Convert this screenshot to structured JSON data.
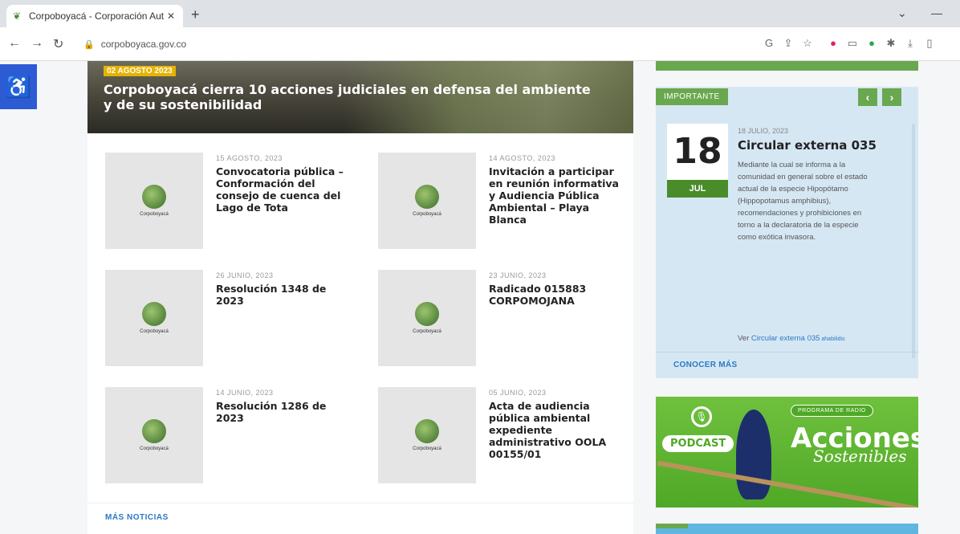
{
  "browser": {
    "tab_title": "Corpoboyacá - Corporación Aut",
    "tab_close": "✕",
    "new_tab": "+",
    "url": "corpoboyaca.gov.co",
    "minimize": "—",
    "chevron": "⌄"
  },
  "hero": {
    "date": "02 AGOSTO 2023",
    "title": "Corpoboyacá cierra 10 acciones judiciales en defensa del ambiente y de su sostenibilidad"
  },
  "news": [
    {
      "date": "15 AGOSTO, 2023",
      "title": "Convocatoria pública – Conformación del consejo de cuenca del Lago de Tota",
      "logo": "Corpoboyacá"
    },
    {
      "date": "14 AGOSTO, 2023",
      "title": "Invitación a participar en reunión informativa y Audiencia Pública Ambiental – Playa Blanca",
      "logo": "Corpoboyacá"
    },
    {
      "date": "26 JUNIO, 2023",
      "title": "Resolución 1348 de 2023",
      "logo": "Corpoboyacá"
    },
    {
      "date": "23 JUNIO, 2023",
      "title": "Radicado 015883 CORPOMOJANA",
      "logo": "Corpoboyacá"
    },
    {
      "date": "14 JUNIO, 2023",
      "title": "Resolución 1286 de 2023",
      "logo": "Corpoboyacá"
    },
    {
      "date": "05 JUNIO, 2023",
      "title": "Acta de audiencia pública ambiental expediente administrativo OOLA 00155/01",
      "logo": "Corpoboyacá"
    }
  ],
  "more_news": "MÁS NOTICIAS",
  "importante": {
    "label": "IMPORTANTE",
    "prev": "‹",
    "next": "›",
    "day": "18",
    "month": "JUL",
    "post_date": "18 JULIO, 2023",
    "post_title": "Circular externa 035",
    "post_body": "Mediante la cual se informa a la comunidad en general sobre el estado actual de la especie Hipopótamo (Hippopotamus amphibius), recomendaciones y prohibiciones en torno a la declaratoria de la especie como exótica invasora.",
    "link_prefix": "Ver ",
    "link_text": "Circular externa 035",
    "link_suffix": " ahabilidis",
    "conocer": "CONOCER MÁS"
  },
  "podcast": {
    "badge": "PODCAST",
    "radio": "PROGRAMA DE RADIO",
    "title": "Acciones",
    "subtitle": "Sostenibles"
  }
}
